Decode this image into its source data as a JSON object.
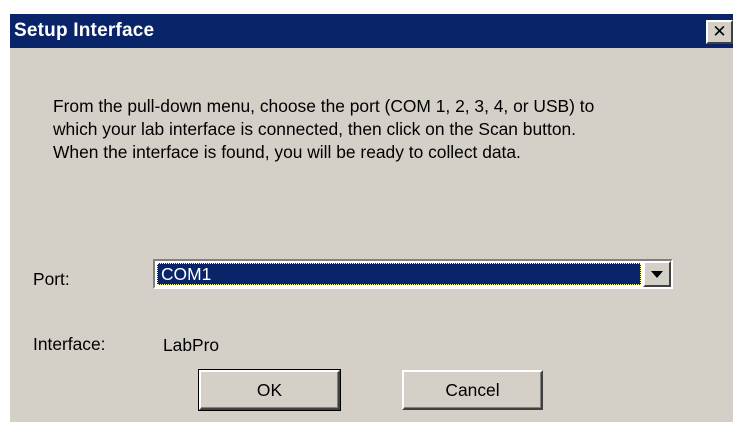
{
  "dialog": {
    "title": "Setup Interface",
    "close_label": "✕",
    "instructions": [
      "From the pull-down menu, choose the port (COM 1, 2, 3, 4, or USB) to",
      "which your lab interface is connected, then click on the Scan button.",
      "When the interface is found, you will be ready to collect data."
    ],
    "port": {
      "label": "Port:",
      "selected": "COM1"
    },
    "interface": {
      "label": "Interface:",
      "value": "LabPro"
    },
    "buttons": {
      "ok": "OK",
      "cancel": "Cancel"
    }
  },
  "colors": {
    "title_bar": "#0a246a",
    "face": "#d4d0c8",
    "selection": "#0a246a"
  },
  "icons": {
    "close": "close-icon",
    "dropdown": "chevron-down-icon"
  }
}
